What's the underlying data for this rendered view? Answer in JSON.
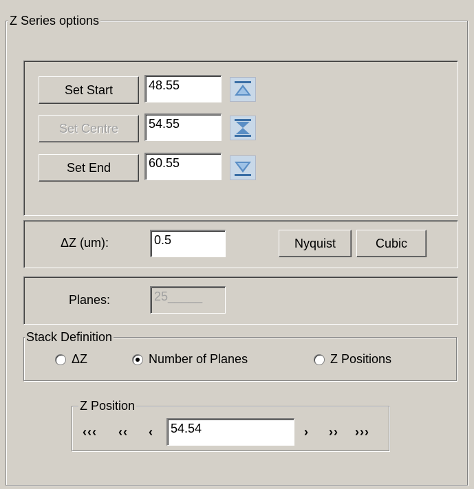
{
  "group": {
    "title": "Z Series options"
  },
  "range": {
    "start": {
      "button": "Set Start",
      "value": "48.55",
      "icon": "arrow-to-top-icon"
    },
    "centre": {
      "button": "Set Centre",
      "value": "54.55",
      "icon": "arrows-to-centre-icon"
    },
    "end": {
      "button": "Set End",
      "value": "60.55",
      "icon": "arrow-to-bottom-icon"
    }
  },
  "step": {
    "label": "ΔZ (um):",
    "value": "0.5",
    "nyquist": "Nyquist",
    "cubic": "Cubic"
  },
  "planes": {
    "label": "Planes:",
    "value": "25_____"
  },
  "stack": {
    "title": "Stack Definition",
    "options": [
      "ΔZ",
      "Number of Planes",
      "Z Positions"
    ],
    "selected": "Number of Planes"
  },
  "zpos": {
    "title": "Z Position",
    "value": "54.54",
    "nav": [
      "‹‹‹",
      "‹‹",
      "‹",
      "›",
      "››",
      "›››"
    ]
  }
}
